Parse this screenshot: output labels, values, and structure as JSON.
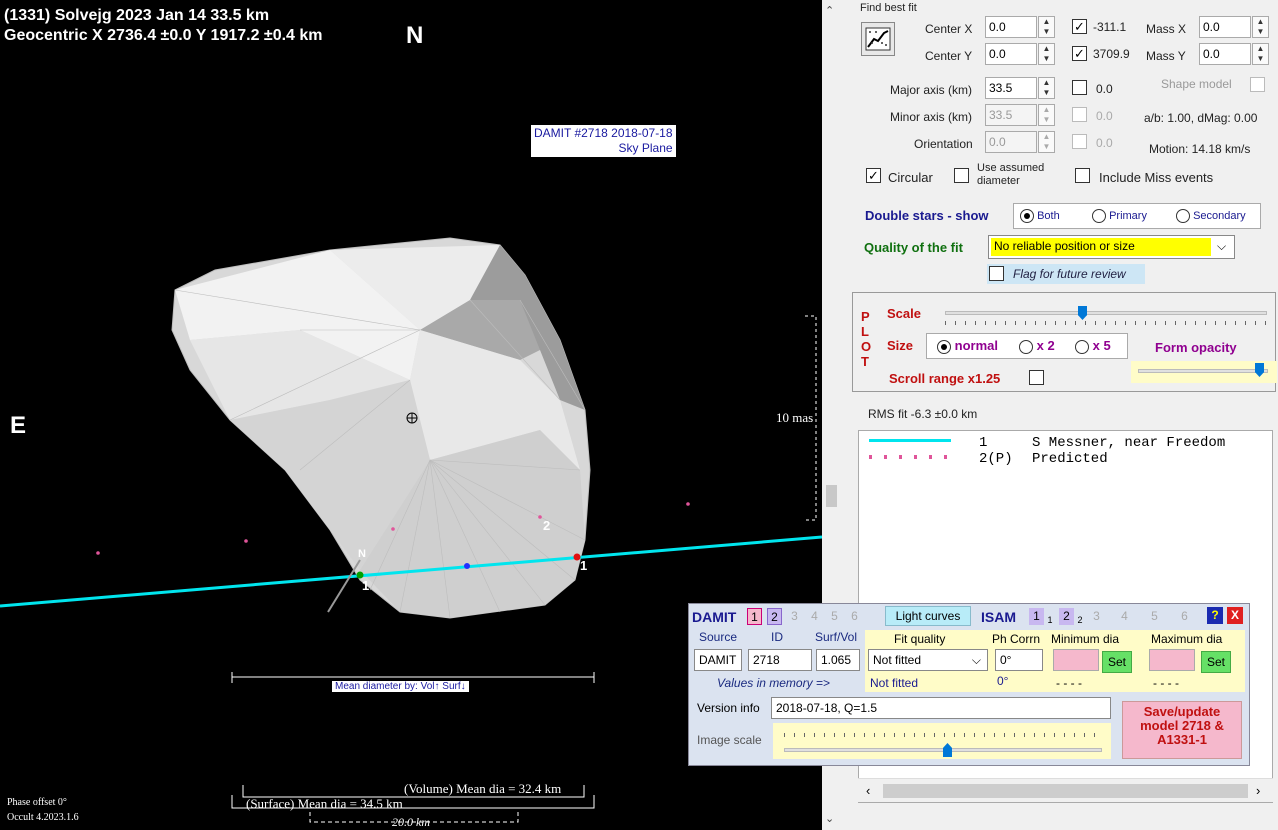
{
  "plot": {
    "header_line1": "(1331) Solvejg  2023 Jan 14   33.5 km",
    "header_line2": "Geocentric  X  2736.4 ±0.0  Y 1917.2 ±0.4 km",
    "north_label": "N",
    "east_label": "E",
    "damit_line1": "DAMIT #2718 2018-07-18",
    "damit_line2": "Sky Plane",
    "scale_label": "10 mas",
    "chord1_label": "1",
    "chord2_label": "2",
    "chord1_end_label": "1",
    "pole_label": "N",
    "mean_dia_by": "Mean diameter by: Vol↑ Surf↓",
    "vol_mean": "(Volume) Mean dia = 32.4 km",
    "surf_mean": "(Surface) Mean dia = 34.5 km",
    "km_scale": "20.0 km",
    "phase_offset": "Phase offset 0°",
    "version": "Occult 4.2023.1.6"
  },
  "fit": {
    "title": "Find best fit",
    "center_x_label": "Center X",
    "center_x": "0.0",
    "center_y_label": "Center Y",
    "center_y": "0.0",
    "cx_check_val": "-311.1",
    "cy_check_val": "3709.9",
    "mass_x_label": "Mass X",
    "mass_x": "0.0",
    "mass_y_label": "Mass Y",
    "mass_y": "0.0",
    "major_label": "Major axis (km)",
    "major": "33.5",
    "major_check_val": "0.0",
    "minor_label": "Minor axis (km)",
    "minor": "33.5",
    "minor_check_val": "0.0",
    "orient_label": "Orientation",
    "orient": "0.0",
    "orient_check_val": "0.0",
    "shape_model": "Shape model",
    "ab_info": "a/b: 1.00, dMag: 0.00",
    "motion": "Motion: 14.18 km/s",
    "circular": "Circular",
    "use_assumed": "Use assumed diameter",
    "include_miss": "Include Miss events",
    "double_stars": "Double stars - show",
    "both": "Both",
    "primary": "Primary",
    "secondary": "Secondary",
    "quality_label": "Quality of the fit",
    "quality_value": "No reliable position or size",
    "flag_review": "Flag for future review"
  },
  "plotctl": {
    "letters": [
      "P",
      "L",
      "O",
      "T"
    ],
    "scale": "Scale",
    "size": "Size",
    "normal": "normal",
    "x2": "x 2",
    "x5": "x 5",
    "form_opacity": "Form opacity",
    "scroll_range": "Scroll range x1.25"
  },
  "rms": "RMS fit -6.3 ±0.0 km",
  "legend": [
    {
      "num": "1",
      "text": "S Messner, near Freedom",
      "color": "#00e5ee"
    },
    {
      "num": "2(P)",
      "text": "Predicted",
      "color": "#e0559a"
    }
  ],
  "damit": {
    "title": "DAMIT",
    "nums": [
      "1",
      "2",
      "3",
      "4",
      "5",
      "6"
    ],
    "light_curves": "Light curves",
    "isam": "ISAM",
    "isam_nums": [
      "1",
      "1",
      "2",
      "2",
      "3",
      "4",
      "5",
      "6"
    ],
    "help": "?",
    "close": "X",
    "source_h": "Source",
    "id_h": "ID",
    "surf_h": "Surf/Vol",
    "fitq_h": "Fit quality",
    "phcorr_h": "Ph Corrn",
    "min_h": "Minimum dia",
    "max_h": "Maximum dia",
    "source": "DAMIT",
    "id": "2718",
    "surf": "1.065",
    "fitq": "Not fitted",
    "phcorr": "0°",
    "set": "Set",
    "mem_label": "Values in memory =>",
    "mem_fitq": "Not fitted",
    "mem_ph": "0°",
    "mem_min": "- - - -",
    "mem_max": "- - - -",
    "version_label": "Version info",
    "version": "2018-07-18, Q=1.5",
    "image_scale": "Image scale",
    "save": "Save/update model 2718 & A1331-1"
  }
}
